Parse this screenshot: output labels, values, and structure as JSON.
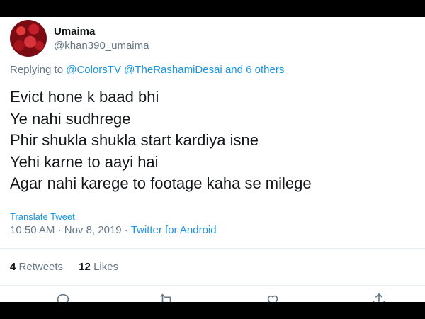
{
  "user": {
    "display_name": "Umaima",
    "handle": "@khan390_umaima"
  },
  "reply_context": {
    "prefix": "Replying to",
    "mention1": "@ColorsTV",
    "mention2": "@TheRashamiDesai",
    "others": "and 6 others"
  },
  "tweet": {
    "lines": [
      "Evict hone k baad bhi",
      "Ye nahi sudhrege",
      "Phir shukla shukla start kardiya isne",
      "Yehi karne to aayi hai",
      "Agar nahi karege to footage kaha se milege"
    ],
    "translate_label": "Translate Tweet",
    "time": "10:50 AM",
    "date": "Nov 8, 2019",
    "source": "Twitter for Android"
  },
  "stats": {
    "retweets_count": "4",
    "retweets_label": "Retweets",
    "likes_count": "12",
    "likes_label": "Likes"
  },
  "actions": [
    "reply-icon",
    "retweet-icon",
    "like-icon",
    "share-icon"
  ],
  "colors": {
    "link": "#1b95e0",
    "muted": "#657786",
    "text": "#14171a"
  }
}
